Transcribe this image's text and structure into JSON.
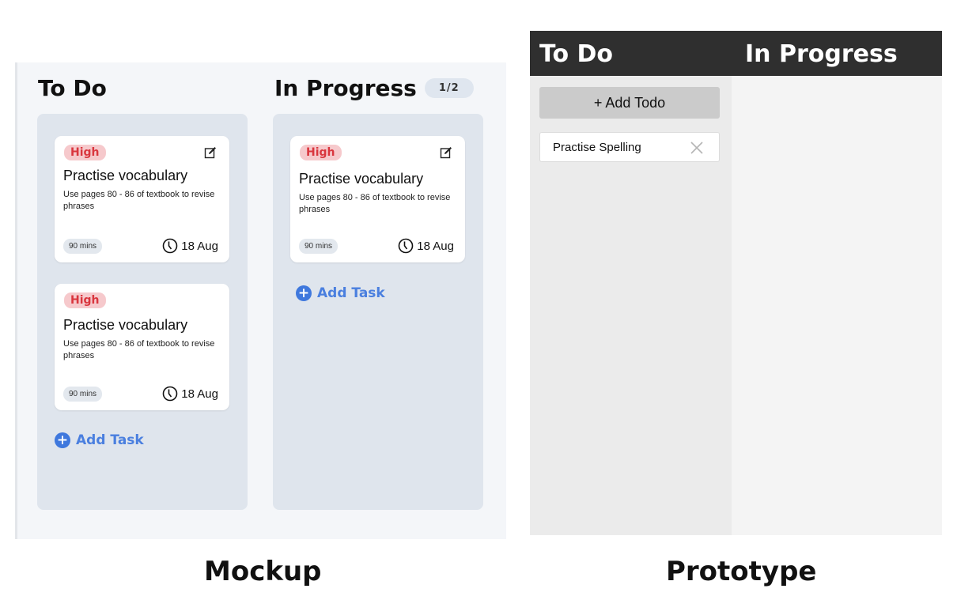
{
  "mockup": {
    "columns": [
      {
        "title": "To Do",
        "cards": [
          {
            "priority": "High",
            "title": "Practise vocabulary",
            "description": "Use pages 80 - 86 of textbook to revise phrases",
            "duration": "90 mins",
            "due": "18 Aug",
            "editable": true
          },
          {
            "priority": "High",
            "title": "Practise vocabulary",
            "description": "Use pages 80 - 86 of textbook to revise phrases",
            "duration": "90 mins",
            "due": "18 Aug",
            "editable": false
          }
        ],
        "add_label": "Add Task"
      },
      {
        "title": "In Progress",
        "count": "1/2",
        "cards": [
          {
            "priority": "High",
            "title": "Practise vocabulary",
            "description": "Use pages 80 - 86 of textbook to revise phrases",
            "duration": "90 mins",
            "due": "18 Aug",
            "editable": true
          }
        ],
        "add_label": "Add Task"
      }
    ],
    "caption": "Mockup"
  },
  "prototype": {
    "columns": [
      "To Do",
      "In Progress"
    ],
    "add_todo_label": "+ Add Todo",
    "tasks": [
      {
        "label": "Practise Spelling"
      }
    ],
    "caption": "Prototype"
  },
  "colors": {
    "priority_high_bg": "#f6c9cc",
    "priority_high_text": "#d9363e",
    "add_task_blue": "#4a7fdf",
    "prototype_header": "#2f2f2f"
  }
}
